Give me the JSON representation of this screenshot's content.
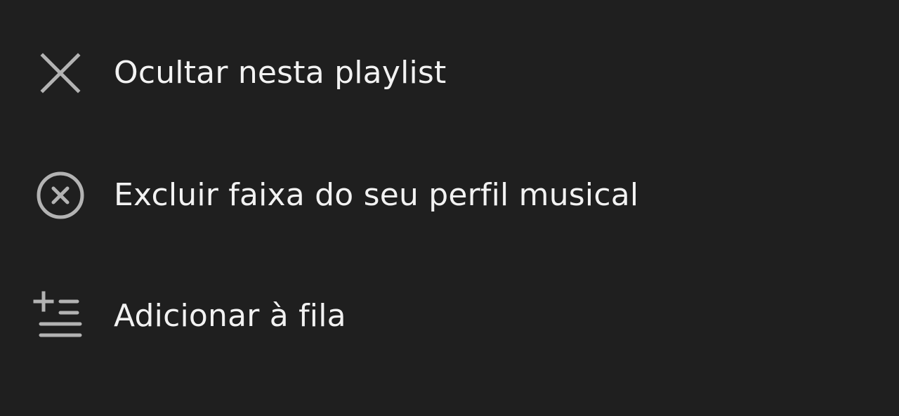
{
  "menu": {
    "items": [
      {
        "label": "Ocultar nesta playlist",
        "icon": "close-icon"
      },
      {
        "label": "Excluir faixa do seu perfil musical",
        "icon": "remove-circle-icon"
      },
      {
        "label": "Adicionar à fila",
        "icon": "add-to-queue-icon"
      }
    ]
  },
  "colors": {
    "background": "#1f1f1f",
    "text": "#f2f2f2",
    "icon": "#b3b3b3"
  }
}
